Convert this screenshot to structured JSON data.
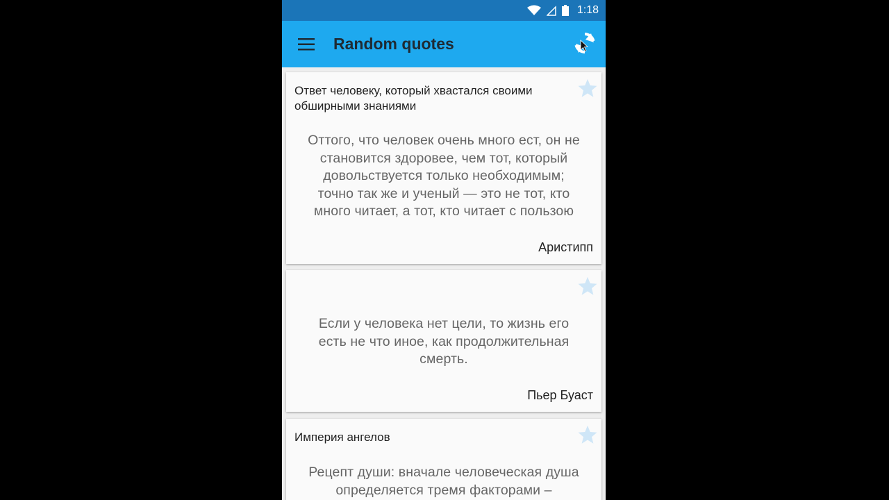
{
  "status_bar": {
    "time": "1:18"
  },
  "app_bar": {
    "title": "Random quotes",
    "menu_icon": "hamburger-menu-icon",
    "refresh_icon": "refresh-icon"
  },
  "colors": {
    "app_bar": "#1ea9ef",
    "status_bar": "#1b75b8",
    "star": "#cfe6f7"
  },
  "quotes": [
    {
      "title": "Ответ человеку, который хвастался своими обширными знаниями",
      "lines": [
        "Оттого, что человек очень много ест, он не",
        "становится здоровее, чем тот, который",
        "довольствуется только необходимым;",
        "точно так же и ученый — это не тот, кто",
        "много читает, а тот, кто читает с пользою"
      ],
      "author": "Аристипп",
      "favorite": false
    },
    {
      "title": "",
      "lines": [
        "Если у человека нет цели, то жизнь его",
        "есть не что иное, как продолжительная",
        "смерть."
      ],
      "author": "Пьер Буаст",
      "favorite": false
    },
    {
      "title": "Империя ангелов",
      "lines": [
        "Рецепт души: вначале человеческая душа",
        "определяется тремя факторами –"
      ],
      "author": "",
      "favorite": false
    }
  ]
}
